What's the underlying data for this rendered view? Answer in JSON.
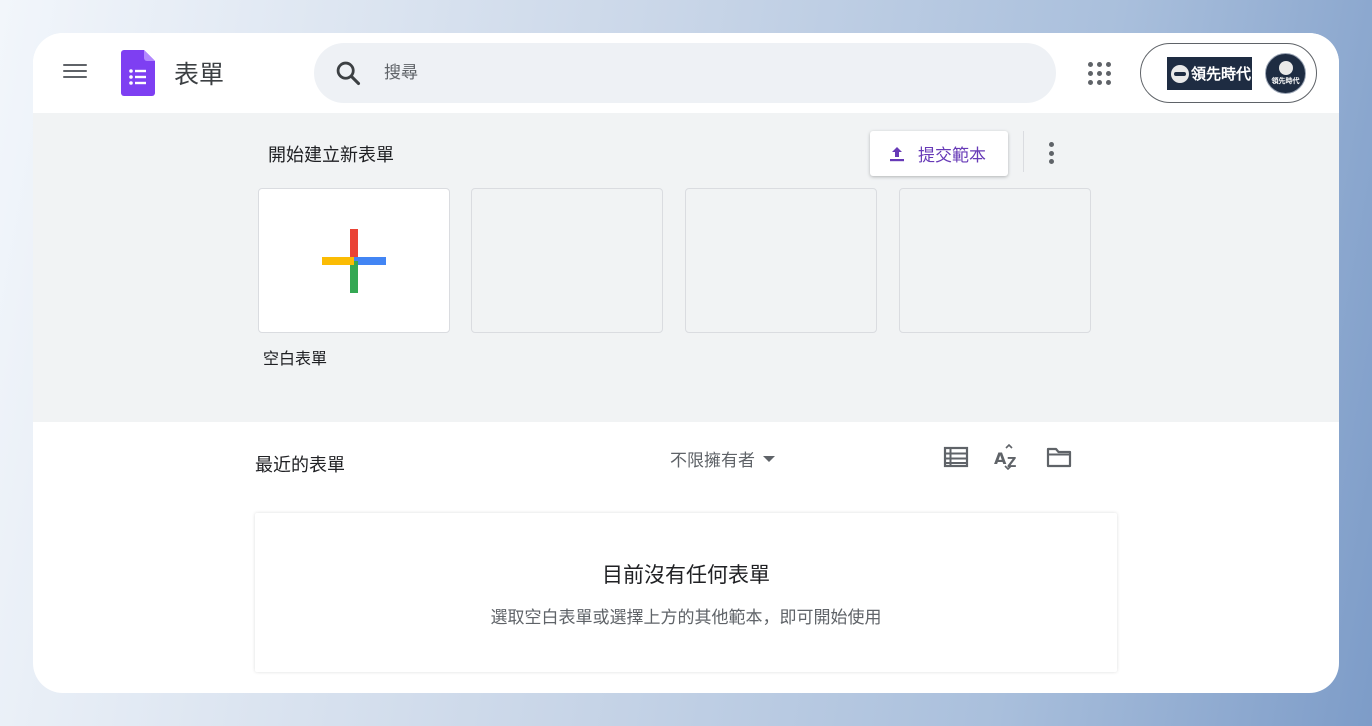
{
  "header": {
    "app_title": "表單",
    "search_placeholder": "搜尋",
    "brand_text": "領先時代",
    "avatar_text": "領先時代"
  },
  "templates": {
    "section_title": "開始建立新表單",
    "submit_template_label": "提交範本",
    "cards": [
      {
        "label": "空白表單",
        "icon": "plus-icon"
      },
      {
        "label": "",
        "icon": ""
      },
      {
        "label": "",
        "icon": ""
      },
      {
        "label": "",
        "icon": ""
      }
    ]
  },
  "recent": {
    "title": "最近的表單",
    "owner_filter": "不限擁有者",
    "view_icons": [
      "list-view-icon",
      "sort-az-icon",
      "folder-icon"
    ],
    "empty_title": "目前沒有任何表單",
    "empty_subtitle": "選取空白表單或選擇上方的其他範本，即可開始使用"
  },
  "colors": {
    "forms_purple": "#673ab7",
    "template_bg": "#f1f3f4",
    "search_bg": "#eef1f5",
    "brand_navy": "#1e2c42"
  }
}
